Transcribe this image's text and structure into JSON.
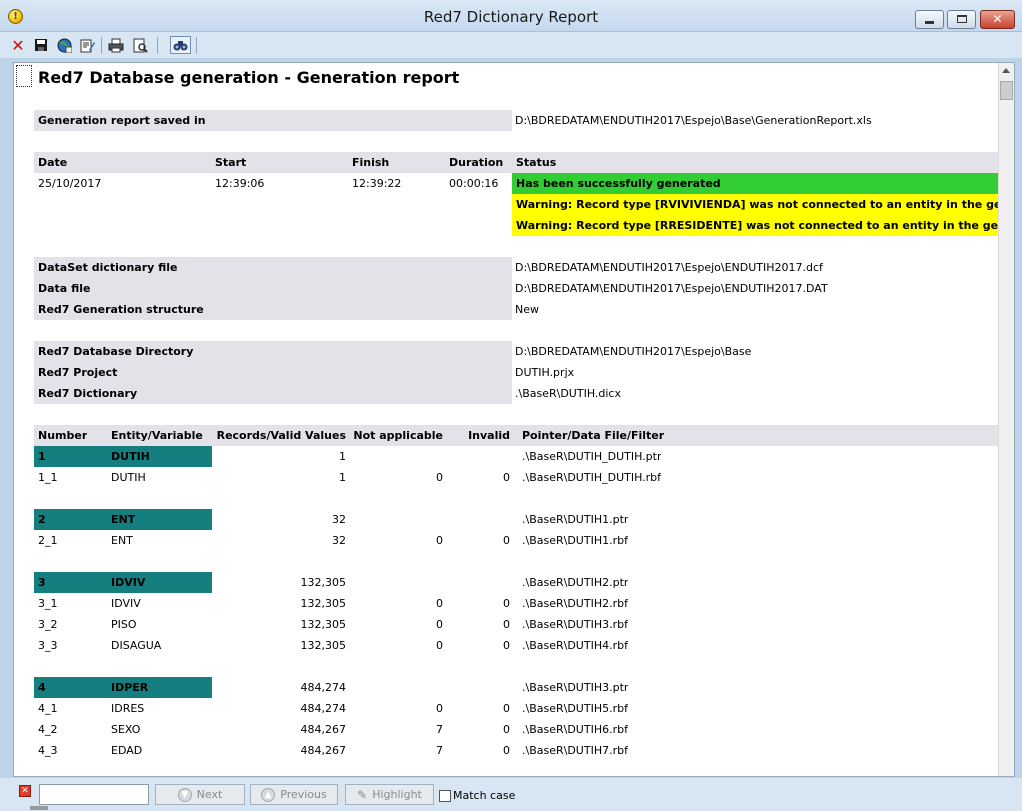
{
  "window": {
    "title": "Red7 Dictionary Report"
  },
  "toolbar": {
    "icons": [
      "close-report-icon",
      "save-icon",
      "web-export-icon",
      "edit-icon",
      "print-icon",
      "print-preview-icon",
      "find-icon"
    ]
  },
  "report": {
    "title": "Red7 Database generation - Generation report",
    "saved": {
      "label": "Generation report saved in",
      "value": "D:\\BDREDATAM\\ENDUTIH2017\\Espejo\\Base\\GenerationReport.xls"
    },
    "status_table": {
      "headers": {
        "date": "Date",
        "start": "Start",
        "finish": "Finish",
        "duration": "Duration",
        "status": "Status"
      },
      "row": {
        "date": "25/10/2017",
        "start": "12:39:06",
        "finish": "12:39:22",
        "duration": "00:00:16"
      },
      "messages": [
        {
          "text": "Has been successfully generated",
          "level": "success",
          "color": "#32cd32"
        },
        {
          "text": "Warning: Record type [RVIVIVIENDA] was not connected to an entity in the generation",
          "level": "warning",
          "color": "#ffff00"
        },
        {
          "text": "Warning: Record type [RRESIDENTE] was not connected to an entity in the generation",
          "level": "warning",
          "color": "#ffff00"
        }
      ]
    },
    "files": [
      {
        "label": "DataSet dictionary file",
        "value": "D:\\BDREDATAM\\ENDUTIH2017\\Espejo\\ENDUTIH2017.dcf"
      },
      {
        "label": "Data file",
        "value": "D:\\BDREDATAM\\ENDUTIH2017\\Espejo\\ENDUTIH2017.DAT"
      },
      {
        "label": "Red7 Generation structure",
        "value": "New"
      }
    ],
    "database": [
      {
        "label": "Red7 Database Directory",
        "value": "D:\\BDREDATAM\\ENDUTIH2017\\Espejo\\Base"
      },
      {
        "label": "Red7 Project",
        "value": "DUTIH.prjx"
      },
      {
        "label": "Red7 Dictionary",
        "value": ".\\BaseR\\DUTIH.dicx"
      }
    ],
    "entities_table": {
      "headers": {
        "number": "Number",
        "entity": "Entity/Variable",
        "records": "Records/Valid Values",
        "not_applicable": "Not applicable",
        "invalid": "Invalid",
        "pointer": "Pointer/Data File/Filter"
      },
      "groups": [
        {
          "entity": {
            "number": "1",
            "name": "DUTIH",
            "records": "1",
            "pointer": ".\\BaseR\\DUTIH_DUTIH.ptr"
          },
          "variables": [
            {
              "number": "1_1",
              "name": "DUTIH",
              "records": "1",
              "not_applicable": "0",
              "invalid": "0",
              "pointer": ".\\BaseR\\DUTIH_DUTIH.rbf"
            }
          ]
        },
        {
          "entity": {
            "number": "2",
            "name": "ENT",
            "records": "32",
            "pointer": ".\\BaseR\\DUTIH1.ptr"
          },
          "variables": [
            {
              "number": "2_1",
              "name": "ENT",
              "records": "32",
              "not_applicable": "0",
              "invalid": "0",
              "pointer": ".\\BaseR\\DUTIH1.rbf"
            }
          ]
        },
        {
          "entity": {
            "number": "3",
            "name": "IDVIV",
            "records": "132,305",
            "pointer": ".\\BaseR\\DUTIH2.ptr"
          },
          "variables": [
            {
              "number": "3_1",
              "name": "IDVIV",
              "records": "132,305",
              "not_applicable": "0",
              "invalid": "0",
              "pointer": ".\\BaseR\\DUTIH2.rbf"
            },
            {
              "number": "3_2",
              "name": "PISO",
              "records": "132,305",
              "not_applicable": "0",
              "invalid": "0",
              "pointer": ".\\BaseR\\DUTIH3.rbf"
            },
            {
              "number": "3_3",
              "name": "DISAGUA",
              "records": "132,305",
              "not_applicable": "0",
              "invalid": "0",
              "pointer": ".\\BaseR\\DUTIH4.rbf"
            }
          ]
        },
        {
          "entity": {
            "number": "4",
            "name": "IDPER",
            "records": "484,274",
            "pointer": ".\\BaseR\\DUTIH3.ptr"
          },
          "variables": [
            {
              "number": "4_1",
              "name": "IDRES",
              "records": "484,274",
              "not_applicable": "0",
              "invalid": "0",
              "pointer": ".\\BaseR\\DUTIH5.rbf"
            },
            {
              "number": "4_2",
              "name": "SEXO",
              "records": "484,267",
              "not_applicable": "7",
              "invalid": "0",
              "pointer": ".\\BaseR\\DUTIH6.rbf"
            },
            {
              "number": "4_3",
              "name": "EDAD",
              "records": "484,267",
              "not_applicable": "7",
              "invalid": "0",
              "pointer": ".\\BaseR\\DUTIH7.rbf"
            }
          ]
        }
      ],
      "entity_color": "#157f80"
    }
  },
  "findbar": {
    "search_value": "",
    "next_label": "Next",
    "previous_label": "Previous",
    "highlight_label": "Highlight",
    "match_case_label": "Match case"
  }
}
